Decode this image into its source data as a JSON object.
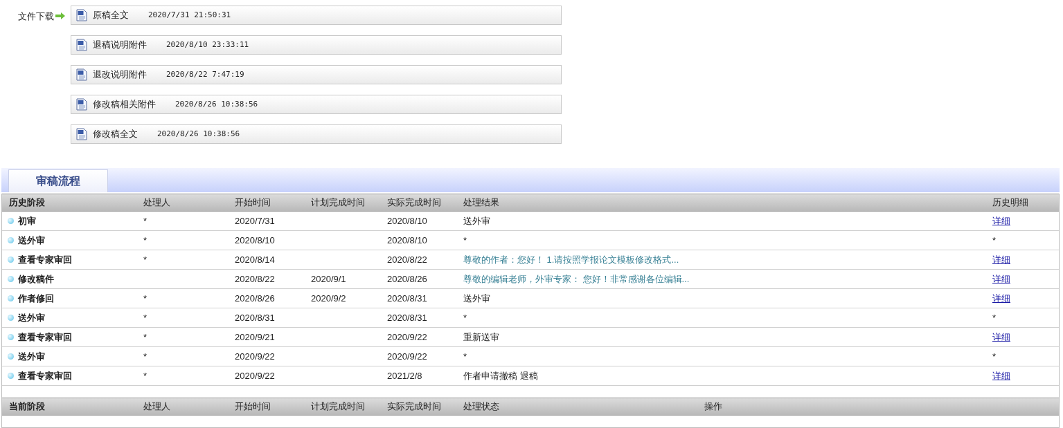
{
  "downloads": {
    "label": "文件下载",
    "files": [
      {
        "name": "原稿全文",
        "time": "2020/7/31 21:50:31"
      },
      {
        "name": "退稿说明附件",
        "time": "2020/8/10 23:33:11"
      },
      {
        "name": "退改说明附件",
        "time": "2020/8/22 7:47:19"
      },
      {
        "name": "修改稿相关附件",
        "time": "2020/8/26 10:38:56"
      },
      {
        "name": "修改稿全文",
        "time": "2020/8/26 10:38:56"
      }
    ]
  },
  "tabs": [
    {
      "label": "审稿流程",
      "selected": true
    }
  ],
  "history": {
    "columns": [
      "历史阶段",
      "处理人",
      "开始时间",
      "计划完成时间",
      "实际完成时间",
      "处理结果",
      "历史明细"
    ],
    "rows": [
      {
        "stage": "初审",
        "handler": "*",
        "start": "2020/7/31",
        "actual": "2020/8/10",
        "result": {
          "kind": "text",
          "text": "送外审"
        },
        "detail": {
          "kind": "link",
          "text": "详细"
        }
      },
      {
        "stage": "送外审",
        "handler": "*",
        "start": "2020/8/10",
        "actual": "2020/8/10",
        "result": {
          "kind": "text",
          "text": "*"
        },
        "detail": {
          "kind": "text",
          "text": "*"
        }
      },
      {
        "stage": "查看专家审回",
        "handler": "*",
        "start": "2020/8/14",
        "actual": "2020/8/22",
        "result": {
          "kind": "link",
          "text": "尊敬的作者：您好！ 1.请按照学报论文模板修改格式..."
        },
        "detail": {
          "kind": "link",
          "text": "详细"
        }
      },
      {
        "stage": "修改稿件",
        "start": "2020/8/22",
        "planned": "2020/9/1",
        "actual": "2020/8/26",
        "result": {
          "kind": "link",
          "text": "尊敬的编辑老师，外审专家： 您好！非常感谢各位编辑..."
        },
        "detail": {
          "kind": "link",
          "text": "详细"
        }
      },
      {
        "stage": "作者修回",
        "handler": "*",
        "start": "2020/8/26",
        "planned": "2020/9/2",
        "actual": "2020/8/31",
        "result": {
          "kind": "text",
          "text": "送外审"
        },
        "detail": {
          "kind": "link",
          "text": "详细"
        }
      },
      {
        "stage": "送外审",
        "handler": "*",
        "start": "2020/8/31",
        "actual": "2020/8/31",
        "result": {
          "kind": "text",
          "text": "*"
        },
        "detail": {
          "kind": "text",
          "text": "*"
        }
      },
      {
        "stage": "查看专家审回",
        "handler": "*",
        "start": "2020/9/21",
        "actual": "2020/9/22",
        "result": {
          "kind": "text",
          "text": "重新送审"
        },
        "detail": {
          "kind": "link",
          "text": "详细"
        }
      },
      {
        "stage": "送外审",
        "handler": "*",
        "start": "2020/9/22",
        "actual": "2020/9/22",
        "result": {
          "kind": "text",
          "text": "*"
        },
        "detail": {
          "kind": "text",
          "text": "*"
        }
      },
      {
        "stage": "查看专家审回",
        "handler": "*",
        "start": "2020/9/22",
        "actual": "2021/2/8",
        "result": {
          "kind": "text",
          "text": "作者申请撤稿 退稿"
        },
        "detail": {
          "kind": "link",
          "text": "详细"
        }
      }
    ]
  },
  "current": {
    "columns": [
      "当前阶段",
      "处理人",
      "开始时间",
      "计划完成时间",
      "实际完成时间",
      "处理状态",
      "操作"
    ]
  }
}
